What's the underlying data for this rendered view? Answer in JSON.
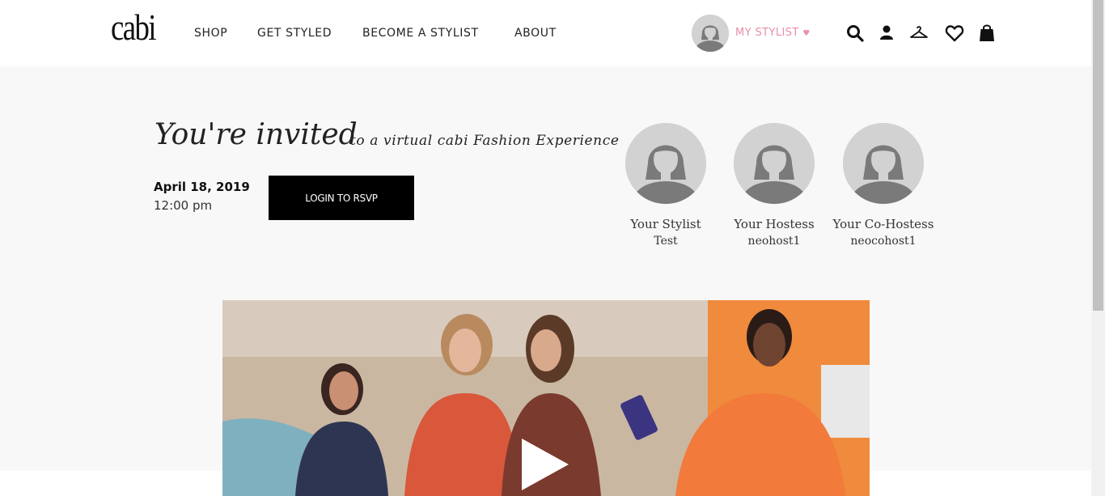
{
  "brand": {
    "logo_text": "cabi"
  },
  "nav": {
    "items": [
      {
        "label": "SHOP"
      },
      {
        "label": "GET STYLED"
      },
      {
        "label": "BECOME A STYLIST"
      },
      {
        "label": "ABOUT"
      }
    ]
  },
  "header": {
    "my_stylist_label": "MY STYLIST",
    "icons": [
      "search-icon",
      "account-icon",
      "hanger-icon",
      "heart-icon",
      "shopping-bag-icon"
    ]
  },
  "invite": {
    "title": "You're invited",
    "subtitle": "to a virtual cabi Fashion Experience",
    "date": "April 18, 2019",
    "time": "12:00 pm",
    "rsvp_label": "LOGIN TO RSVP"
  },
  "hosts": [
    {
      "role": "Your Stylist",
      "name": "Test"
    },
    {
      "role": "Your Hostess",
      "name": "neohost1"
    },
    {
      "role": "Your Co-Hostess",
      "name": "neocohost1"
    }
  ],
  "colors": {
    "accent_pink": "#e98fa6",
    "button_black": "#000000",
    "page_bg": "#f8f8f8"
  }
}
